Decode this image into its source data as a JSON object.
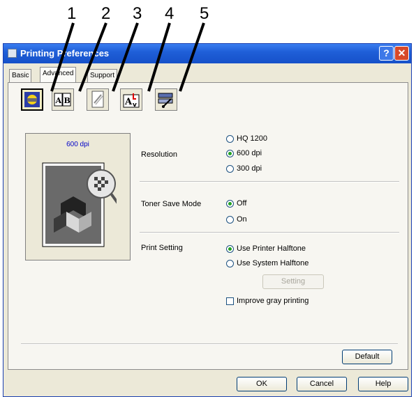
{
  "callouts": [
    "1",
    "2",
    "3",
    "4",
    "5"
  ],
  "window": {
    "title": "Printing Preferences"
  },
  "tabs": [
    {
      "label": "Basic"
    },
    {
      "label": "Advanced"
    },
    {
      "label": "Support"
    }
  ],
  "toolbar": [
    {
      "icon": "print-quality-icon"
    },
    {
      "icon": "duplex-ab-icon"
    },
    {
      "icon": "watermark-icon"
    },
    {
      "icon": "page-setting-icon"
    },
    {
      "icon": "device-options-icon"
    }
  ],
  "preview": {
    "label": "600 dpi"
  },
  "resolution": {
    "label": "Resolution",
    "options": [
      "HQ 1200",
      "600 dpi",
      "300 dpi"
    ],
    "selected": "600 dpi"
  },
  "toner": {
    "label": "Toner Save Mode",
    "options": [
      "Off",
      "On"
    ],
    "selected": "Off"
  },
  "print_setting": {
    "label": "Print Setting",
    "options": [
      "Use Printer Halftone",
      "Use System Halftone"
    ],
    "selected": "Use Printer Halftone",
    "setting_button": "Setting",
    "improve_gray": "Improve gray printing"
  },
  "buttons": {
    "default": "Default",
    "ok": "OK",
    "cancel": "Cancel",
    "help": "Help"
  },
  "colors": {
    "title_bar": "#1f5fd8",
    "dialog_bg": "#ece9d8",
    "preview_label": "#0000c8"
  }
}
